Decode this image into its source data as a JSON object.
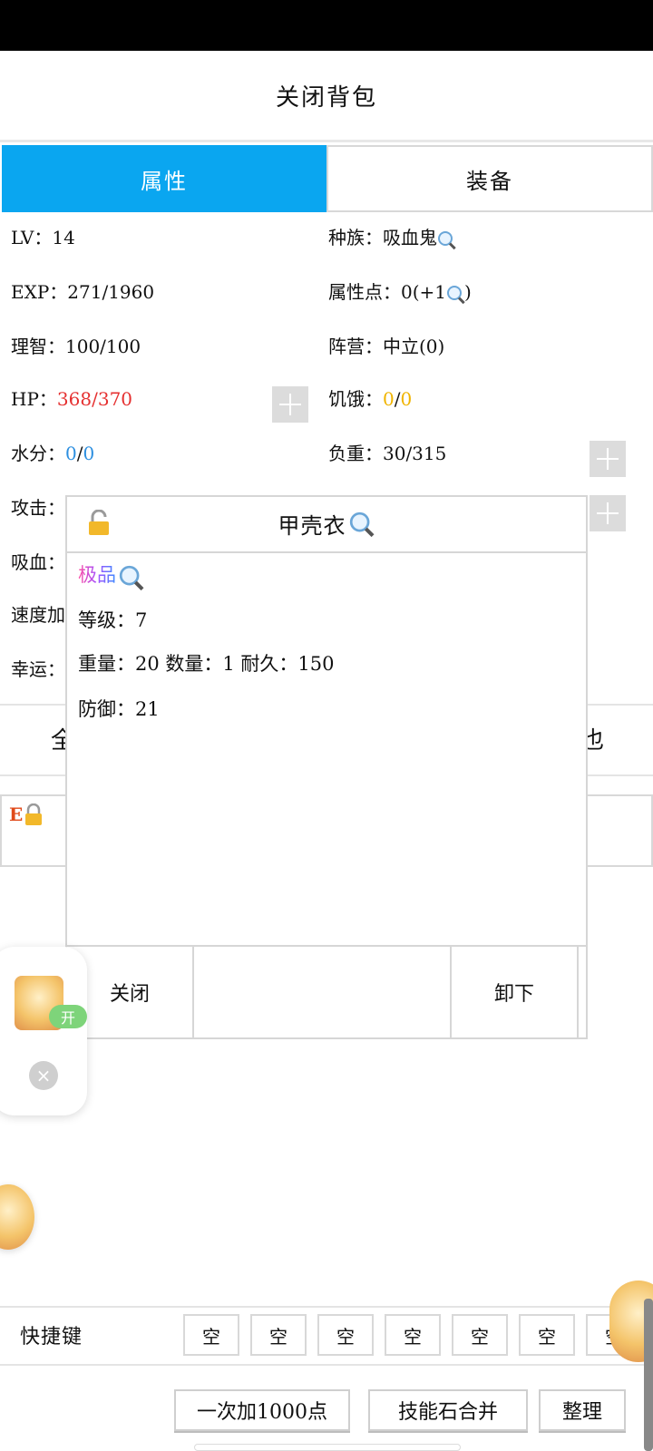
{
  "header": {
    "close_bag": "关闭背包"
  },
  "tabs": [
    {
      "label": "属性",
      "active": true
    },
    {
      "label": "装备",
      "active": false
    }
  ],
  "stats": {
    "lv": "LV：14",
    "race_label": "种族：",
    "race_value": "吸血鬼",
    "exp": "EXP：271/1960",
    "attr_points_label": "属性点：",
    "attr_points_value": "0(+1",
    "attr_points_close": ")",
    "sanity": "理智：100/100",
    "faction": "阵营：中立(0)",
    "hp_label": "HP：",
    "hp_current": "368",
    "hp_sep": "/",
    "hp_max": "370",
    "hunger_label": "饥饿：",
    "hunger_current": "0",
    "hunger_sep": "/",
    "hunger_max": "0",
    "water_label": "水分：",
    "water_current": "0",
    "water_sep": "/",
    "water_max": "0",
    "weight": "负重：30/315",
    "attack_label_partial": "攻击：",
    "lifesteal_label_partial": "吸血：",
    "speed_label_partial": "速度加",
    "luck_label_partial": "幸运：",
    "row_left_partial": "全",
    "row_right_partial": "也",
    "slot_tag": "E"
  },
  "popup": {
    "title": "甲壳衣",
    "grade": "极品",
    "level": "等级：7",
    "info": "重量：20  数量：1  耐久：150",
    "defense": "防御：21",
    "close_button": "关闭",
    "unequip_button": "卸下"
  },
  "float_widget": {
    "toggle": "开",
    "close": "×"
  },
  "quickbar": {
    "label": "快捷键",
    "slots": [
      "空",
      "空",
      "空",
      "空",
      "空",
      "空",
      "空"
    ]
  },
  "bottom_buttons": {
    "add_1000": "一次加1000点",
    "merge_stones": "技能石合并",
    "sort": "整理"
  },
  "colors": {
    "tab_active": "#0aa6f0",
    "hp": "#e53030",
    "hunger": "#f0b400",
    "water": "#2d8fe0"
  }
}
